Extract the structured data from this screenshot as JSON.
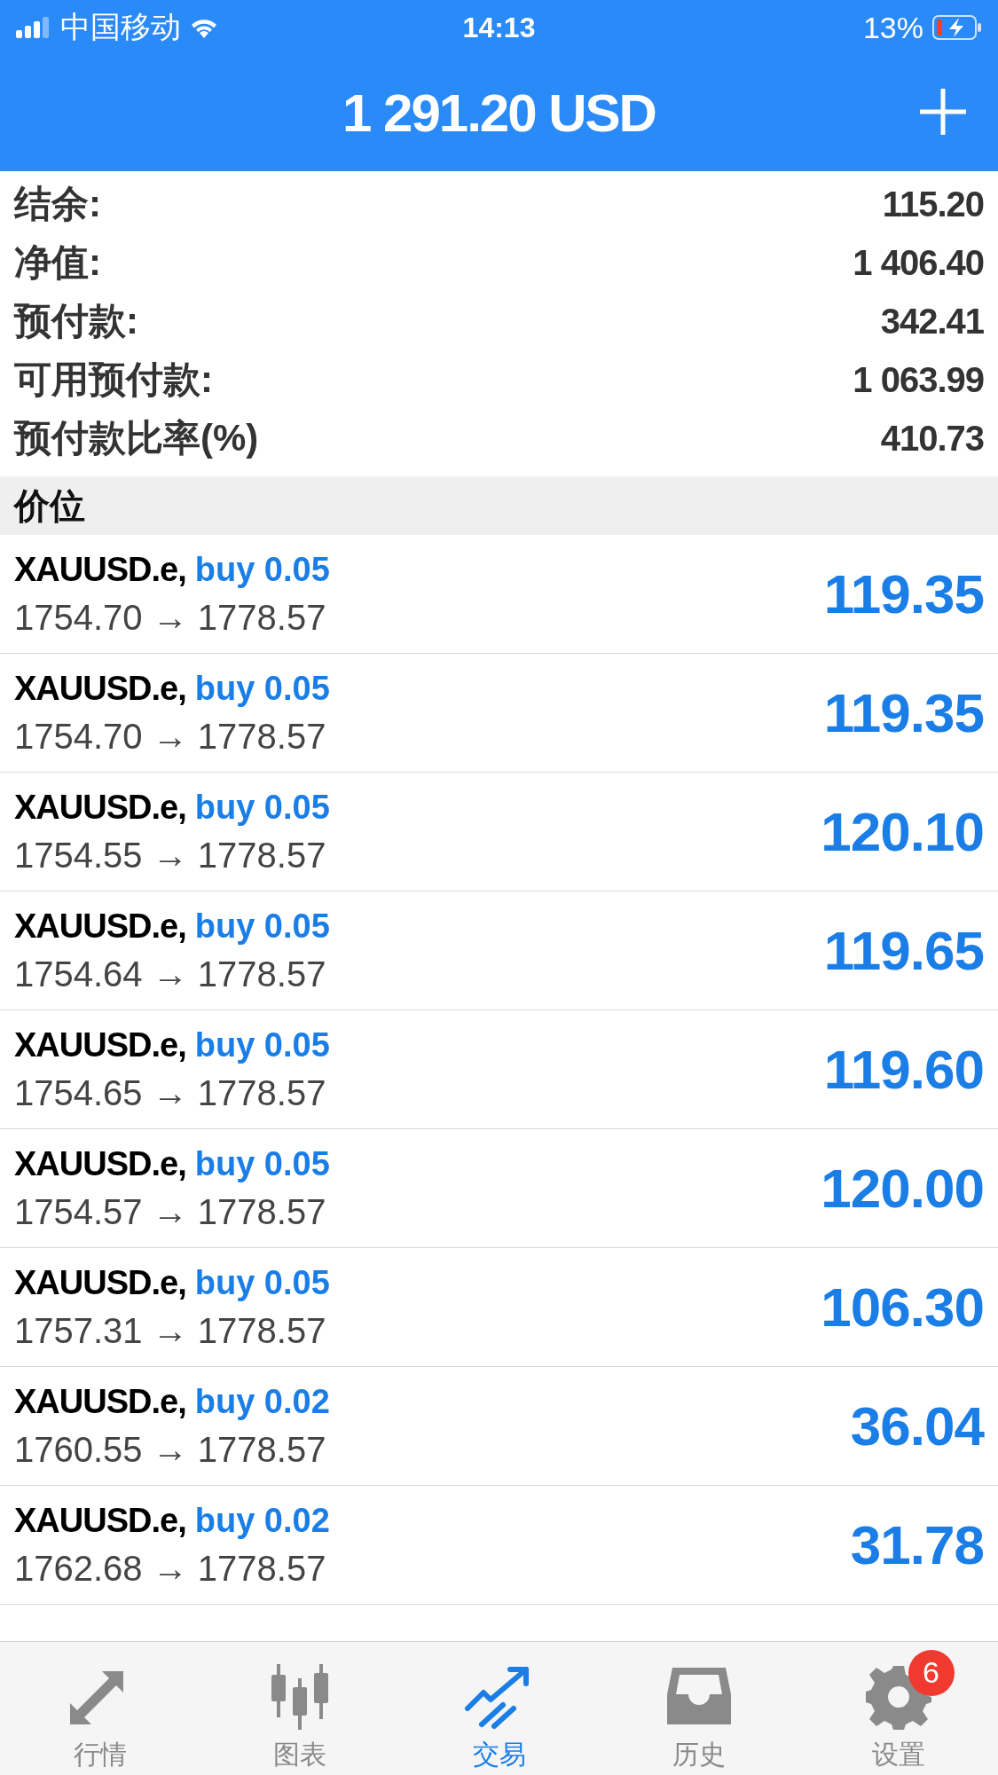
{
  "status_bar": {
    "carrier": "中国移动",
    "time": "14:13",
    "battery": "13%"
  },
  "header": {
    "title": "1 291.20 USD"
  },
  "summary": [
    {
      "label": "结余:",
      "value": "115.20"
    },
    {
      "label": "净值:",
      "value": "1 406.40"
    },
    {
      "label": "预付款:",
      "value": "342.41"
    },
    {
      "label": "可用预付款:",
      "value": "1 063.99"
    },
    {
      "label": "预付款比率(%)",
      "value": "410.73"
    }
  ],
  "section": {
    "title": "价位"
  },
  "positions": [
    {
      "symbol": "XAUUSD.e,",
      "direction": "buy",
      "volume": "0.05",
      "prices": "1754.70 → 1778.57",
      "profit": "119.35"
    },
    {
      "symbol": "XAUUSD.e,",
      "direction": "buy",
      "volume": "0.05",
      "prices": "1754.70 → 1778.57",
      "profit": "119.35"
    },
    {
      "symbol": "XAUUSD.e,",
      "direction": "buy",
      "volume": "0.05",
      "prices": "1754.55 → 1778.57",
      "profit": "120.10"
    },
    {
      "symbol": "XAUUSD.e,",
      "direction": "buy",
      "volume": "0.05",
      "prices": "1754.64 → 1778.57",
      "profit": "119.65"
    },
    {
      "symbol": "XAUUSD.e,",
      "direction": "buy",
      "volume": "0.05",
      "prices": "1754.65 → 1778.57",
      "profit": "119.60"
    },
    {
      "symbol": "XAUUSD.e,",
      "direction": "buy",
      "volume": "0.05",
      "prices": "1754.57 → 1778.57",
      "profit": "120.00"
    },
    {
      "symbol": "XAUUSD.e,",
      "direction": "buy",
      "volume": "0.05",
      "prices": "1757.31 → 1778.57",
      "profit": "106.30"
    },
    {
      "symbol": "XAUUSD.e,",
      "direction": "buy",
      "volume": "0.02",
      "prices": "1760.55 → 1778.57",
      "profit": "36.04"
    },
    {
      "symbol": "XAUUSD.e,",
      "direction": "buy",
      "volume": "0.02",
      "prices": "1762.68 → 1778.57",
      "profit": "31.78"
    }
  ],
  "tab_bar": [
    {
      "kind": "quotes",
      "label": "行情",
      "selected": false
    },
    {
      "kind": "chart",
      "label": "图表",
      "selected": false
    },
    {
      "kind": "trade",
      "label": "交易",
      "selected": true
    },
    {
      "kind": "history",
      "label": "历史",
      "selected": false
    },
    {
      "kind": "settings",
      "label": "设置",
      "selected": false,
      "badge": "6"
    }
  ]
}
